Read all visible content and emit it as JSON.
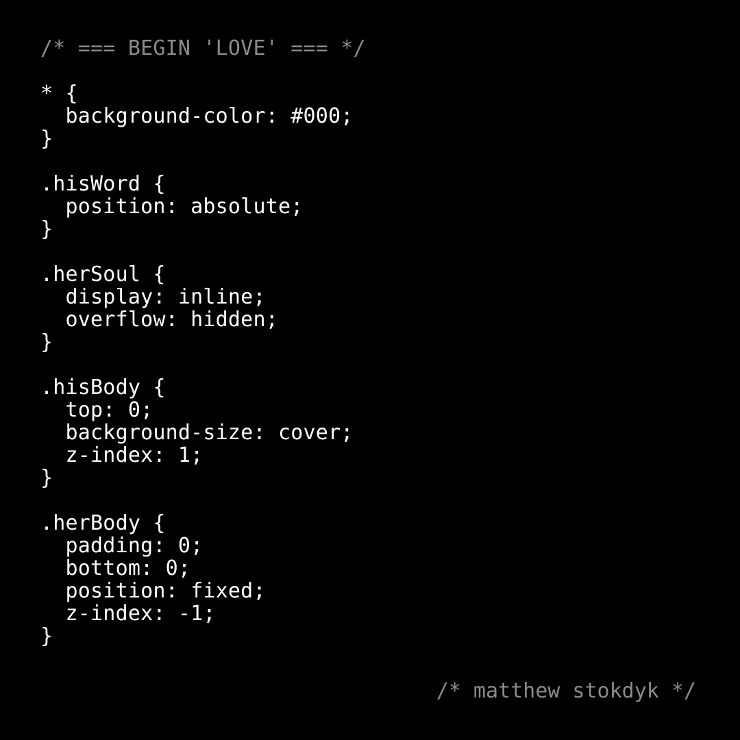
{
  "colors": {
    "background": "#000000",
    "code_text": "#ffffff",
    "comment_text": "#8a8a8a"
  },
  "code": {
    "lines": [
      "/* === BEGIN 'LOVE' === */",
      "",
      "* {",
      "  background-color: #000;",
      "}",
      "",
      ".hisWord {",
      "  position: absolute;",
      "}",
      "",
      ".herSoul {",
      "  display: inline;",
      "  overflow: hidden;",
      "}",
      "",
      ".hisBody {",
      "  top: 0;",
      "  background-size: cover;",
      "  z-index: 1;",
      "}",
      "",
      ".herBody {",
      "  padding: 0;",
      "  bottom: 0;",
      "  position: fixed;",
      "  z-index: -1;",
      "}"
    ]
  },
  "signature": "/* matthew stokdyk */"
}
